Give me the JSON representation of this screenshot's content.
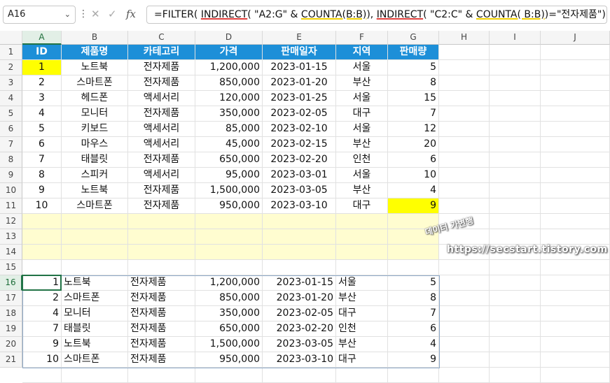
{
  "formula_bar": {
    "name_box": "A16",
    "chevron": "⌄",
    "separator": "⋮",
    "cancel_icon": "✕",
    "enter_icon": "✓",
    "fx_icon": "fx",
    "formula_parts": [
      {
        "text": "=FILTER( ",
        "style": ""
      },
      {
        "text": "INDIRECT",
        "style": "ul-r"
      },
      {
        "text": "( \"A2:G\" & ",
        "style": ""
      },
      {
        "text": "COUNTA(B:B)",
        "style": "ul-y"
      },
      {
        "text": "), ",
        "style": ""
      },
      {
        "text": "INDIRECT",
        "style": "ul-r"
      },
      {
        "text": "( \"C2:C\" & ",
        "style": ""
      },
      {
        "text": "COUNTA( B:B)",
        "style": "ul-y"
      },
      {
        "text": ")=\"전자제품\")",
        "style": ""
      }
    ]
  },
  "columns": [
    "A",
    "B",
    "C",
    "D",
    "E",
    "F",
    "G",
    "H",
    "I",
    "J"
  ],
  "row_numbers": [
    "1",
    "2",
    "3",
    "4",
    "5",
    "6",
    "7",
    "8",
    "9",
    "10",
    "11",
    "12",
    "13",
    "14",
    "15",
    "16",
    "17",
    "18",
    "19",
    "20",
    "21"
  ],
  "header_row": [
    "ID",
    "제품명",
    "카테고리",
    "가격",
    "판매일자",
    "지역",
    "판매량"
  ],
  "source_rows": [
    [
      "1",
      "노트북",
      "전자제품",
      "1,200,000",
      "2023-01-15",
      "서울",
      "5"
    ],
    [
      "2",
      "스마트폰",
      "전자제품",
      "850,000",
      "2023-01-20",
      "부산",
      "8"
    ],
    [
      "3",
      "헤드폰",
      "액세서리",
      "120,000",
      "2023-01-25",
      "서울",
      "15"
    ],
    [
      "4",
      "모니터",
      "전자제품",
      "350,000",
      "2023-02-05",
      "대구",
      "7"
    ],
    [
      "5",
      "키보드",
      "액세서리",
      "85,000",
      "2023-02-10",
      "서울",
      "12"
    ],
    [
      "6",
      "마우스",
      "액세서리",
      "45,000",
      "2023-02-15",
      "부산",
      "20"
    ],
    [
      "7",
      "태블릿",
      "전자제품",
      "650,000",
      "2023-02-20",
      "인천",
      "6"
    ],
    [
      "8",
      "스피커",
      "액세서리",
      "95,000",
      "2023-03-01",
      "서울",
      "10"
    ],
    [
      "9",
      "노트북",
      "전자제품",
      "1,500,000",
      "2023-03-05",
      "부산",
      "4"
    ],
    [
      "10",
      "스마트폰",
      "전자제품",
      "950,000",
      "2023-03-10",
      "대구",
      "9"
    ]
  ],
  "result_rows": [
    [
      "1",
      "노트북",
      "전자제품",
      "1,200,000",
      "2023-01-15",
      "서울",
      "5"
    ],
    [
      "2",
      "스마트폰",
      "전자제품",
      "850,000",
      "2023-01-20",
      "부산",
      "8"
    ],
    [
      "4",
      "모니터",
      "전자제품",
      "350,000",
      "2023-02-05",
      "대구",
      "7"
    ],
    [
      "7",
      "태블릿",
      "전자제품",
      "650,000",
      "2023-02-20",
      "인천",
      "6"
    ],
    [
      "9",
      "노트북",
      "전자제품",
      "1,500,000",
      "2023-03-05",
      "부산",
      "4"
    ],
    [
      "10",
      "스마트폰",
      "전자제품",
      "950,000",
      "2023-03-10",
      "대구",
      "9"
    ]
  ],
  "overlay": {
    "stamp": "데이터 가변행",
    "url": "https://secstart.tistory.com"
  },
  "colors": {
    "header_fill": "#1d8fd8",
    "highlight": "#ffff00",
    "band": "#fffdd0",
    "selection": "#217346"
  }
}
